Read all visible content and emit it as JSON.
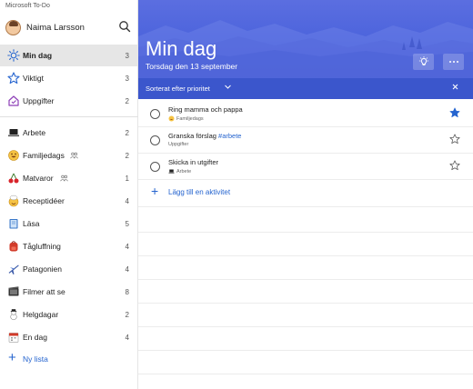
{
  "app": {
    "title": "Microsoft To-Do"
  },
  "profile": {
    "name": "Naima Larsson"
  },
  "sidebar": {
    "smart_lists": [
      {
        "label": "Min dag",
        "count": "3",
        "icon": "sun-icon",
        "active": true
      },
      {
        "label": "Viktigt",
        "count": "3",
        "icon": "star-icon"
      },
      {
        "label": "Uppgifter",
        "count": "2",
        "icon": "home-icon"
      }
    ],
    "lists": [
      {
        "label": "Arbete",
        "count": "2",
        "icon": "laptop-icon"
      },
      {
        "label": "Familjedags",
        "count": "2",
        "icon": "smiley-icon",
        "shared": true
      },
      {
        "label": "Matvaror",
        "count": "1",
        "icon": "cherry-icon",
        "shared": true
      },
      {
        "label": "Receptidéer",
        "count": "4",
        "icon": "chef-icon"
      },
      {
        "label": "Läsa",
        "count": "5",
        "icon": "book-icon"
      },
      {
        "label": "Tågluffning",
        "count": "4",
        "icon": "backpack-icon"
      },
      {
        "label": "Patagonien",
        "count": "4",
        "icon": "airplane-icon"
      },
      {
        "label": "Filmer att se",
        "count": "8",
        "icon": "film-icon"
      },
      {
        "label": "Helgdagar",
        "count": "2",
        "icon": "snowman-icon"
      },
      {
        "label": "En dag",
        "count": "4",
        "icon": "calendar-icon"
      }
    ],
    "new_list_label": "Ny lista"
  },
  "header": {
    "title": "Min dag",
    "subtitle": "Torsdag den 13 september",
    "suggestions_icon": "lightbulb-icon",
    "more_icon": "more-icon"
  },
  "sortbar": {
    "label": "Sorterat efter prioritet"
  },
  "tasks": [
    {
      "title": "Ring mamma och pappa",
      "tag": "",
      "list": "Familjedags",
      "list_icon": "smiley-icon",
      "important": true
    },
    {
      "title": "Granska förslag ",
      "tag": "#arbete",
      "list": "Uppgifter",
      "list_icon": "",
      "important": false
    },
    {
      "title": "Skicka in utgifter",
      "tag": "",
      "list": "Arbete",
      "list_icon": "laptop-icon",
      "important": false
    }
  ],
  "add_task_label": "Lägg till en aktivitet",
  "colors": {
    "accent": "#2564cf",
    "header": "#4b63dc",
    "sortbar": "#3b56cc"
  }
}
